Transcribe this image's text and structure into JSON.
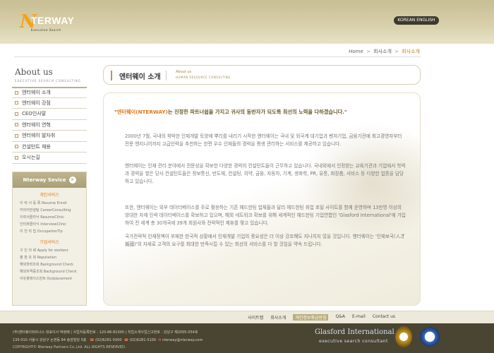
{
  "header": {
    "logo_letter": "N",
    "logo_text": "TERWAY",
    "logo_sub": "Executive Search",
    "lang_label": "KOREAN  ENGLISH"
  },
  "breadcrumb": {
    "home": "Home",
    "sep": ">",
    "level1": "회사소개",
    "current": "회사소개"
  },
  "sidebar": {
    "title": "About us",
    "subtitle": "EXECUTIVE SEARCH CONSULTING",
    "items": [
      {
        "label": "엔터웨이 소개"
      },
      {
        "label": "엔터웨이 강점"
      },
      {
        "label": "CEO인사말"
      },
      {
        "label": "엔터웨이 연혁"
      },
      {
        "label": "엔터웨이 발자취"
      },
      {
        "label": "컨설턴트 채용"
      },
      {
        "label": "오시는길"
      }
    ]
  },
  "services": {
    "heading": "Nterway Sevice",
    "arrow": ">",
    "personal_title": "개인서비스",
    "personal_items": [
      {
        "label": "이 력 서 등 록  Resume Enroll"
      },
      {
        "label": "커리어컨설팅  CareerConsulting"
      },
      {
        "label": "이력서클리닉  ResumeClinic"
      },
      {
        "label": "인터뷰클리닉  InterviewClinic"
      },
      {
        "label": "이 천 직 팁  OccupationTip"
      }
    ],
    "corp_title": "기업서비스",
    "corp_items": [
      {
        "label": "구 인 의 뢰  Apply for workerz"
      },
      {
        "label": "평 판 조 회  Reputation"
      },
      {
        "label": "해외학력조회 Background Check"
      },
      {
        "label": "해외자격증조회 Background Check"
      },
      {
        "label": "아웃플레이스먼트 Outplacement"
      }
    ]
  },
  "page_title": {
    "title": "엔터웨이 소개",
    "sub1": "About us",
    "sub2": "HUMAN RESOURCE CONSULTING"
  },
  "content": {
    "quote_open": "\"",
    "quote_accent": "엔터웨이(NTERWAY)",
    "quote_rest": "는 진정한 파트너쉽을 가지고 귀사의 동반자가 되도록 최선의 노력을 다하겠습니다.\"",
    "p1": "2000년 7월, 국내의 척박한 인재개발 토양에 뿌리를 내리기 시작한 엔터웨이는 국내 및 외국계 대기업과 벤처기업, 금융기관에 최고경영자부터 전문 엔지니어까지 고급인력을 추천하는 한편 우수 인재들의 경력을 평생 관리하는 서비스를 제공하고 있습니다.",
    "p2": "엔터웨이는 인재 관리 분야에서 전문성을 확보한 다양한 경력의 컨설턴트들이 근무하고 있습니다. 국내외에서 인정받는 교육기관과 기업에서 학력과 경력을 쌓은 당사 컨설턴트들은 정보통신, 반도체, 컨설팅, 의약, 금융, 자동차, 기계, 생화학, PR, 유통, 화장품, 서비스 등 다양한 업종을 담당하고 있습니다.",
    "p3": "또한, 엔터웨이는 외부 데이터베이스를 주로 활용하는 기존 헤드헌팅 업체들과 달리 헤드헌팅 취업 포털 사이트를 함께 운영하며 13만명 이상의 방대한 자체 인력 데이터베이스를 확보하고 있으며, 해외 네트워크 확보를 위해 세계적인 헤드헌팅 기업연합인 'Glasford International'에 가입하여 전 세계 총 30개국에 39개 회원사와 전략적인 제휴를 맺고 있습니다.",
    "p4": "국가전략적 인재정책이 부재한 한국적 상황에서 인재개발 기업의 중요성은 더 이상 강조해도 지나치지 않을 것입니다. 엔터웨이는 '인재보국(人才報國)'의 자세로 고객의 요구를 최대한 만족시킬 수 있는 최선의 서비스를 다 할 것임을 약속 드립니다."
  },
  "footer_nav": {
    "items": [
      {
        "label": "사이트맵"
      },
      {
        "label": "회사소개"
      },
      {
        "label": "개인정보취급방침"
      },
      {
        "label": "Q&A"
      },
      {
        "label": "E-mail"
      },
      {
        "label": "Contact us"
      }
    ]
  },
  "footer": {
    "line1": "(주)엔터웨이파트너스 대표이사 박정배  |  사업자등록번호 : 120-86-81000  |  직업소개사업신고번호 : 강남구 제2005-054호",
    "line2_pre": "135-010 서울시 강남구 논현동 84 송암빌딩 5층",
    "tel": "(02)6281-5000",
    "fax": "(02)6281-5100",
    "email": "nterway@nterway.com",
    "line3": "COPYRIGHT© Nterway Partners Co.,Ltd. ALL RIGHTS RESERVED.",
    "glasford": "Glasford International",
    "glasford_sub": "executive  search  consultant"
  }
}
